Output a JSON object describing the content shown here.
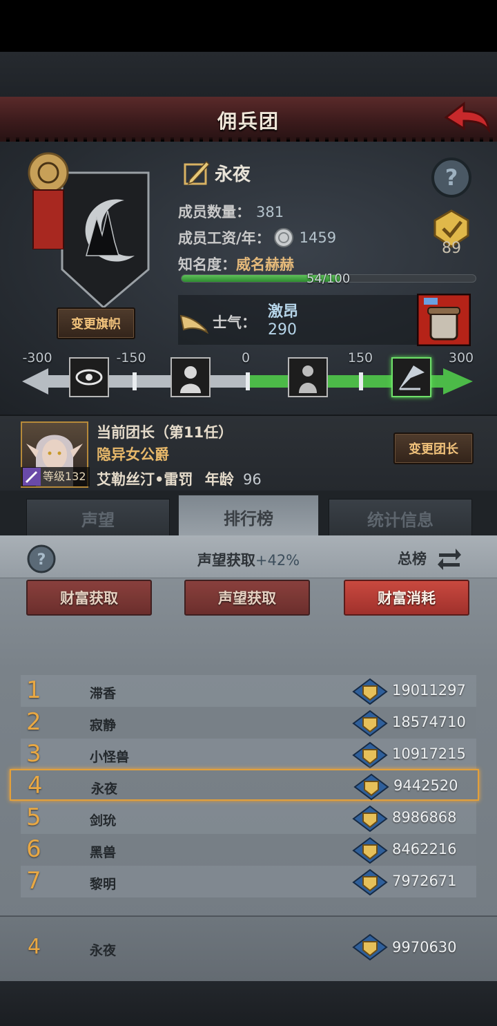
{
  "header": {
    "title": "佣兵团"
  },
  "guild": {
    "name": "永夜",
    "member_count_label": "成员数量：",
    "member_count": "381",
    "salary_label": "成员工资/年：",
    "salary": "1459",
    "fame_label": "知名度：",
    "fame_value": "威名赫赫",
    "fame_progress_text": "54/100",
    "fame_progress": 0.54,
    "change_flag_label": "变更旗帜",
    "badge_count": "89"
  },
  "morale": {
    "label": "士气：",
    "state": "激昂",
    "value": "290",
    "scale_ticks": [
      "-300",
      "-150",
      "0",
      "150",
      "300"
    ]
  },
  "leader": {
    "title": "当前团长（第11任）",
    "rank_title": "隐异女公爵",
    "name": "艾勒丝汀•雷罚",
    "age_label": "年龄",
    "age": "96",
    "level_label": "等级132",
    "change_leader_label": "变更团长"
  },
  "tabs": [
    {
      "label": "声望",
      "active": false
    },
    {
      "label": "排行榜",
      "active": true
    },
    {
      "label": "统计信息",
      "active": false
    }
  ],
  "ranking": {
    "hint_label": "声望获取",
    "hint_pct": "+42%",
    "scope": "总榜",
    "filters": [
      {
        "label": "财富获取",
        "active": false
      },
      {
        "label": "声望获取",
        "active": false
      },
      {
        "label": "财富消耗",
        "active": true
      }
    ],
    "rows": [
      {
        "rank": "1",
        "name": "滞香",
        "value": "19011297"
      },
      {
        "rank": "2",
        "name": "寂静",
        "value": "18574710"
      },
      {
        "rank": "3",
        "name": "小怪兽",
        "value": "10917215"
      },
      {
        "rank": "4",
        "name": "永夜",
        "value": "9442520",
        "me": true
      },
      {
        "rank": "5",
        "name": "剑玧",
        "value": "8986868"
      },
      {
        "rank": "6",
        "name": "黑兽",
        "value": "8462216"
      },
      {
        "rank": "7",
        "name": "黎明",
        "value": "7972671"
      }
    ],
    "mine": {
      "rank": "4",
      "name": "永夜",
      "value": "9970630"
    }
  },
  "colors": {
    "accent_gold": "#e9a843",
    "filter_active": "#c9493f",
    "morale_green": "#4cba48"
  }
}
